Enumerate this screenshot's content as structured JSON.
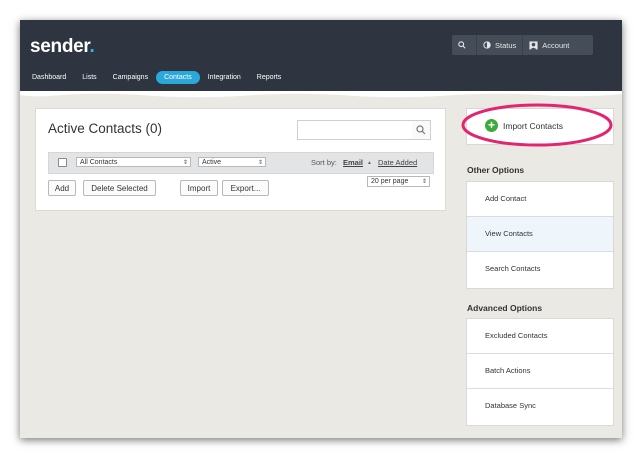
{
  "header": {
    "logo": "sender",
    "logo_dot": ".",
    "topbar": {
      "status": "Status",
      "account": "Account"
    },
    "nav": [
      "Dashboard",
      "Lists",
      "Campaigns",
      "Contacts",
      "Integration",
      "Reports"
    ]
  },
  "main": {
    "title": "Active Contacts (0)",
    "search": {
      "placeholder": ""
    },
    "filter": {
      "list_select": "All Contacts",
      "status_select": "Active",
      "sort_label": "Sort by:",
      "sort_email": "Email",
      "sort_date": "Date Added"
    },
    "buttons": {
      "add": "Add",
      "delete_selected": "Delete Selected",
      "import": "Import",
      "export": "Export..."
    },
    "per_page": "20 per page"
  },
  "sidebar": {
    "import_contacts": "Import Contacts",
    "other_options_title": "Other Options",
    "other_options": [
      "Add Contact",
      "View Contacts",
      "Search Contacts"
    ],
    "advanced_options_title": "Advanced Options",
    "advanced_options": [
      "Excluded Contacts",
      "Batch Actions",
      "Database Sync"
    ]
  },
  "colors": {
    "header_bg": "#2e3540",
    "nav_active": "#2aa8dc",
    "highlight_ring": "#e3256f",
    "plus_icon": "#3cab3c"
  }
}
